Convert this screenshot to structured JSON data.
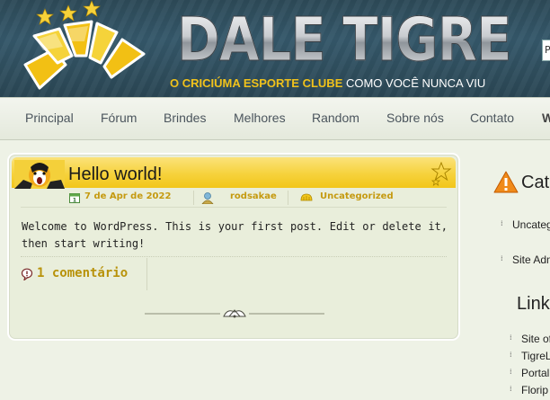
{
  "header": {
    "site_title": "DALE TIGRE",
    "tagline_bold": "O CRICIÚMA ESPORTE CLUBE",
    "tagline_rest": " COMO VOCÊ NUNCA VIU",
    "search_value": "P",
    "colors": {
      "header_bg": "#2d4a58",
      "tagline_gold": "#f1c21b",
      "logo_gold": "#f2c014"
    }
  },
  "nav": {
    "items": [
      "Principal",
      "Fórum",
      "Brindes",
      "Melhores",
      "Random",
      "Sobre nós",
      "Contato",
      "W"
    ]
  },
  "post": {
    "title": "Hello world!",
    "date": "7 de Apr de 2022",
    "author": "rodsakae",
    "category": "Uncategorized",
    "body": "Welcome to WordPress. This is your first post. Edit or delete it, then start writing!",
    "comments": "1 comentário"
  },
  "sidebar": {
    "categories_title": "Cat",
    "categories": [
      "Uncateg",
      "Site Adm"
    ],
    "links_title": "Link",
    "links": [
      "Site of",
      "TigreL",
      "Portal",
      "Florip"
    ]
  }
}
